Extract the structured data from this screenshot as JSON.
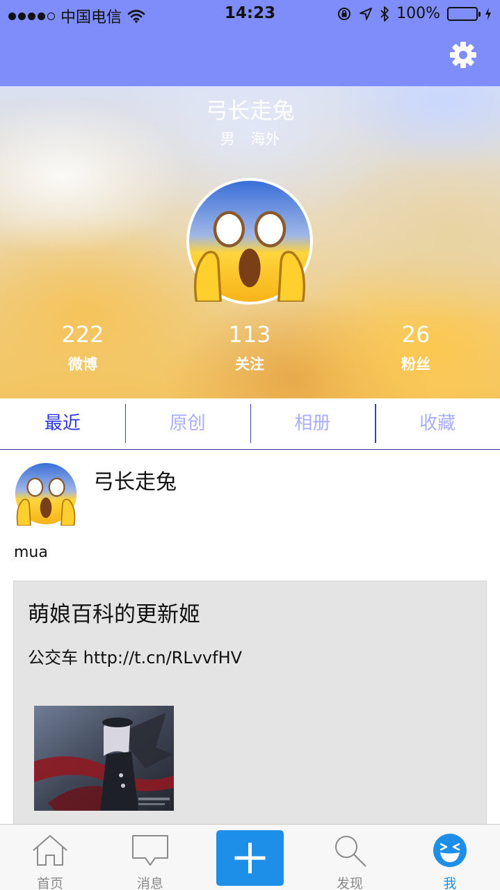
{
  "status_bar": {
    "carrier": "中国电信",
    "time": "14:23",
    "battery": "100%"
  },
  "profile": {
    "name": "弓长走兔",
    "gender": "男",
    "location": "海外",
    "stats": [
      {
        "value": "222",
        "label": "微博"
      },
      {
        "value": "113",
        "label": "关注"
      },
      {
        "value": "26",
        "label": "粉丝"
      }
    ]
  },
  "tabs": [
    {
      "label": "最近",
      "active": true
    },
    {
      "label": "原创",
      "active": false
    },
    {
      "label": "相册",
      "active": false
    },
    {
      "label": "收藏",
      "active": false
    }
  ],
  "post": {
    "author": "弓长走兔",
    "text": "mua",
    "repost": {
      "author": "萌娘百科的更新姬",
      "text": "公交车 http://t.cn/RLvvfHV"
    }
  },
  "tabbar": [
    {
      "label": "首页",
      "icon": "home-icon"
    },
    {
      "label": "消息",
      "icon": "message-icon"
    },
    {
      "label": "",
      "icon": "plus-icon"
    },
    {
      "label": "发现",
      "icon": "search-icon"
    },
    {
      "label": "我",
      "icon": "me-icon",
      "active": true
    }
  ],
  "colors": {
    "nav_bar": "#7f8dfb",
    "tab_active": "#2c35e6",
    "tab_inactive": "#a8aef7",
    "accent": "#1e8fe8"
  }
}
